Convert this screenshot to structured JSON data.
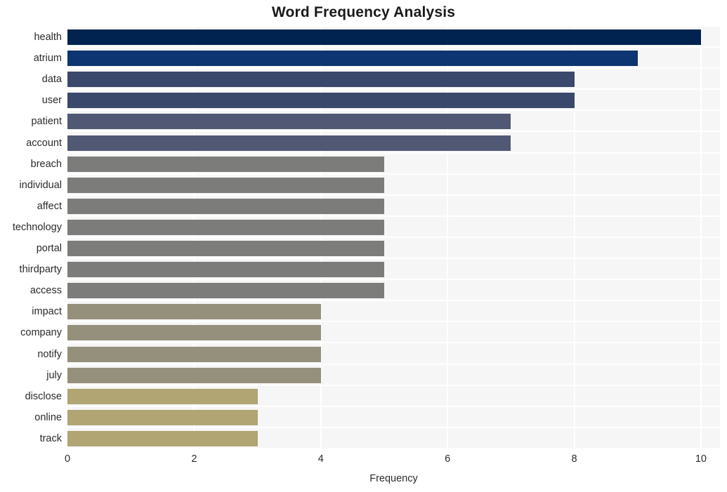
{
  "chart_data": {
    "type": "bar",
    "orientation": "horizontal",
    "title": "Word Frequency Analysis",
    "xlabel": "Frequency",
    "ylabel": "",
    "categories": [
      "health",
      "atrium",
      "data",
      "user",
      "patient",
      "account",
      "breach",
      "individual",
      "affect",
      "technology",
      "portal",
      "thirdparty",
      "access",
      "impact",
      "company",
      "notify",
      "july",
      "disclose",
      "online",
      "track"
    ],
    "values": [
      10,
      9,
      8,
      8,
      7,
      7,
      5,
      5,
      5,
      5,
      5,
      5,
      5,
      4,
      4,
      4,
      4,
      3,
      3,
      3
    ],
    "bar_colors": [
      "#00244f",
      "#0d3571",
      "#3a486c",
      "#3a486c",
      "#515874",
      "#515874",
      "#7c7c7a",
      "#7c7c7a",
      "#7c7c7a",
      "#7c7c7a",
      "#7c7c7a",
      "#7c7c7a",
      "#7c7c7a",
      "#94907b",
      "#94907b",
      "#94907b",
      "#94907b",
      "#b0a573",
      "#b0a573",
      "#b0a573"
    ],
    "xlim": [
      0,
      10.3
    ],
    "xticks": [
      0,
      2,
      4,
      6,
      8,
      10
    ],
    "xtick_labels": [
      "0",
      "2",
      "4",
      "6",
      "8",
      "10"
    ],
    "grid": true,
    "grid_color": "#ffffff",
    "plot_background": "#f6f6f6",
    "figure_background": "#ffffff",
    "legend": null
  }
}
